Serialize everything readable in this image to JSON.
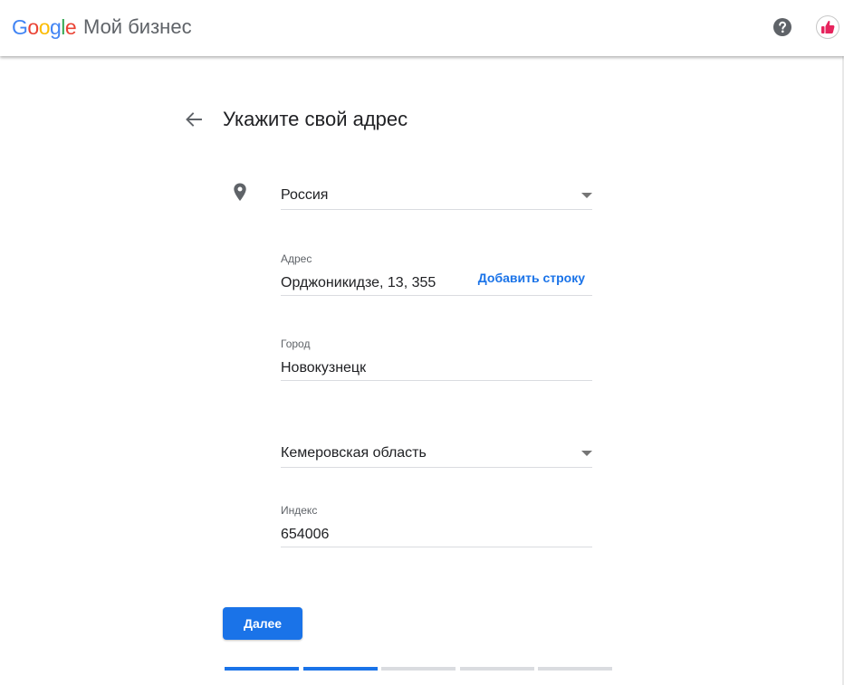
{
  "header": {
    "logo_letters": [
      {
        "char": "G",
        "color": "#4285f4"
      },
      {
        "char": "o",
        "color": "#ea4335"
      },
      {
        "char": "o",
        "color": "#fbbc05"
      },
      {
        "char": "g",
        "color": "#4285f4"
      },
      {
        "char": "l",
        "color": "#34a853"
      },
      {
        "char": "e",
        "color": "#ea4335"
      }
    ],
    "product_name": "Мой бизнес",
    "help_icon": "help-circle-icon",
    "avatar_icon": "thumbs-up-icon"
  },
  "page": {
    "title": "Укажите свой адрес",
    "back_icon": "arrow-back-icon"
  },
  "form": {
    "country": {
      "value": "Россия",
      "icon": "location-pin-icon"
    },
    "address": {
      "label": "Адрес",
      "value": "Орджоникидзе, 13, 355",
      "add_line_label": "Добавить строку"
    },
    "city": {
      "label": "Город",
      "value": "Новокузнецк"
    },
    "region": {
      "value": "Кемеровская область"
    },
    "postal": {
      "label": "Индекс",
      "value": "654006"
    }
  },
  "actions": {
    "next_label": "Далее"
  },
  "progress": {
    "total_steps": 5,
    "completed_steps": 2,
    "active_color": "#1a73e8",
    "inactive_color": "#dadce0"
  },
  "colors": {
    "accent": "#1a73e8",
    "text_primary": "#202124",
    "text_secondary": "#5f6368"
  }
}
